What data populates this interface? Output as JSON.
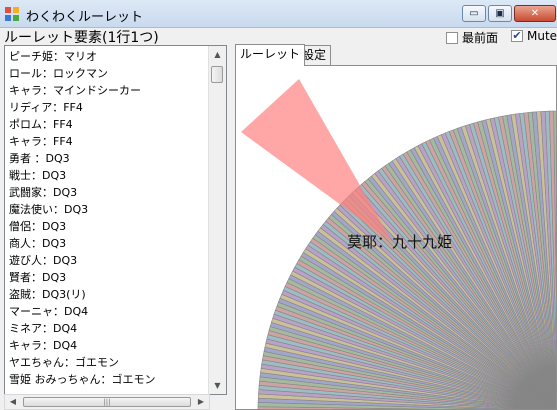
{
  "window": {
    "title": "わくわくルーレット"
  },
  "window_buttons": {
    "minimize": "▭",
    "maximize": "▣",
    "close": "✕"
  },
  "header": {
    "label": "ルーレット要素(1行1つ)"
  },
  "options": {
    "topmost": {
      "label": "最前面",
      "checked": false
    },
    "mute": {
      "label": "Mute",
      "checked": true,
      "check_glyph": "✔"
    }
  },
  "list": {
    "items": [
      "ピーチ姫：マリオ",
      "ロール：ロックマン",
      "キャラ：マインドシーカー",
      "リディア：FF4",
      "ポロム：FF4",
      "キャラ：FF4",
      "勇者 ：DQ3",
      "戦士：DQ3",
      "武闘家：DQ3",
      "魔法使い：DQ3",
      "僧侶：DQ3",
      "商人：DQ3",
      "遊び人：DQ3",
      "賢者：DQ3",
      "盗賊：DQ3(リ)",
      "マーニャ：DQ4",
      "ミネア：DQ4",
      "キャラ：DQ4",
      "ヤエちゃん：ゴエモン",
      "雪姫 おみっちゃん：ゴエモン"
    ]
  },
  "scroll": {
    "up": "▲",
    "down": "▼",
    "left": "◀",
    "right": "▶",
    "grip": "|||"
  },
  "tabs": [
    {
      "label": "ルーレット",
      "active": true
    },
    {
      "label": "設定",
      "active": false
    }
  ],
  "roulette": {
    "result_text": "莫耶：九十九姫",
    "pointer_color": "#ff8080",
    "wheel_colors": [
      "#f7b5b5",
      "#b7d9b0",
      "#b5b8f2",
      "#f2e2a6",
      "#d7b2ef",
      "#a9dde6"
    ]
  }
}
